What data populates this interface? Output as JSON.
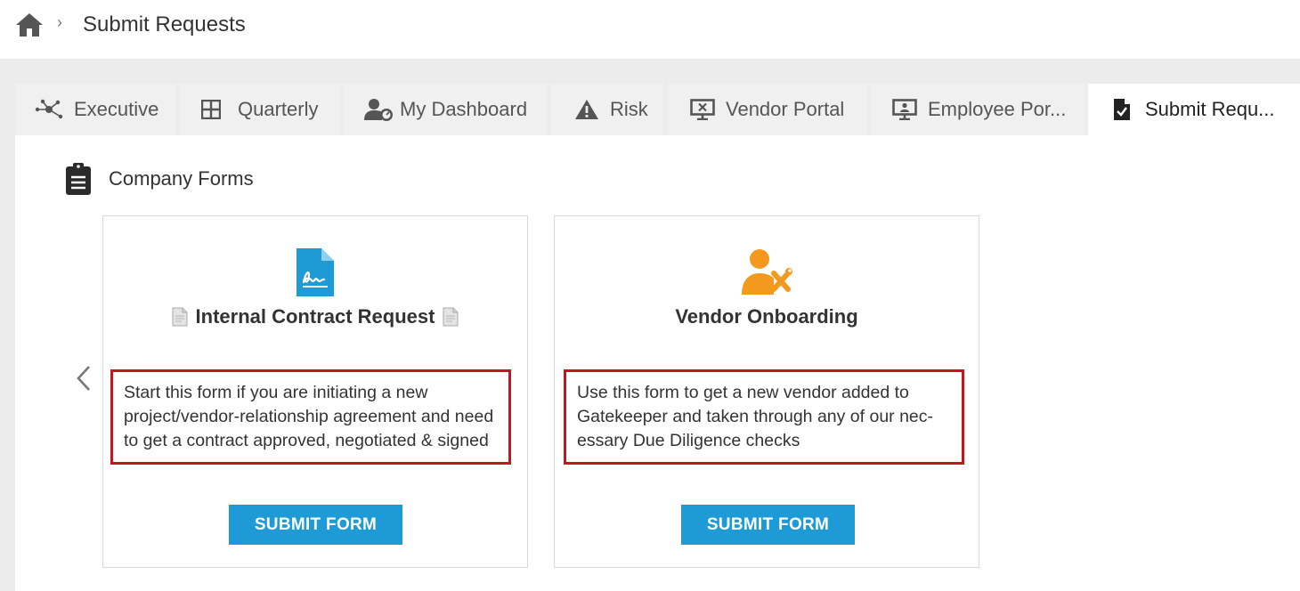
{
  "breadcrumb": {
    "separator": "›",
    "title": "Submit Requests"
  },
  "tabs": [
    {
      "label": "Executive",
      "icon": "network-nodes-icon",
      "active": false
    },
    {
      "label": "Quarterly",
      "icon": "grid-icon",
      "active": false
    },
    {
      "label": "My Dashboard",
      "icon": "user-gauge-icon",
      "active": false
    },
    {
      "label": "Risk",
      "icon": "warning-triangle-icon",
      "active": false
    },
    {
      "label": "Vendor Portal",
      "icon": "monitor-x-icon",
      "active": false
    },
    {
      "label": "Employee Por...",
      "icon": "monitor-user-icon",
      "active": false
    },
    {
      "label": "Submit Requ...",
      "icon": "file-check-icon",
      "active": true
    }
  ],
  "section": {
    "title": "Company Forms",
    "icon": "clipboard-icon"
  },
  "cards": [
    {
      "title": "Internal Contract Request",
      "icon": "contract-signature-icon",
      "description": "Start this form if you are initiating a new project/vendor-relationship agreement and need to get a contract approved, negotiated & signed",
      "button": "SUBMIT FORM"
    },
    {
      "title": "Vendor Onboarding",
      "icon": "user-tools-icon",
      "description": "Use this form to get a new vendor added to Gatekeeper and taken through any of our nec­essary Due Diligence checks",
      "button": "SUBMIT FORM"
    }
  ],
  "colors": {
    "accent": "#1e9bd7",
    "highlight_border": "#c4161c",
    "vendor_icon": "#f39a1e",
    "contract_icon": "#1e9bd7"
  }
}
